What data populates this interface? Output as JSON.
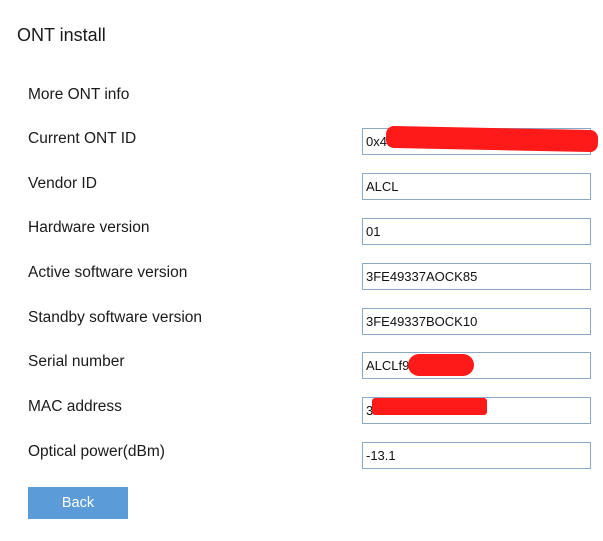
{
  "page": {
    "title": "ONT install",
    "section_title": "More ONT info"
  },
  "rows": [
    {
      "label": "Current ONT ID",
      "value": "0x41"
    },
    {
      "label": "Vendor ID",
      "value": "ALCL"
    },
    {
      "label": "Hardware version",
      "value": "01"
    },
    {
      "label": "Active software version",
      "value": "3FE49337AOCK85"
    },
    {
      "label": "Standby software version",
      "value": "3FE49337BOCK10"
    },
    {
      "label": "Serial number",
      "value": "ALCLf9"
    },
    {
      "label": "MAC address",
      "value": "3"
    },
    {
      "label": "Optical power(dBm)",
      "value": "-13.1"
    }
  ],
  "actions": {
    "back_label": "Back"
  },
  "colors": {
    "button_bg": "#5b9bd8",
    "field_border": "#8aa8c8",
    "redaction": "#ff1a1a"
  }
}
